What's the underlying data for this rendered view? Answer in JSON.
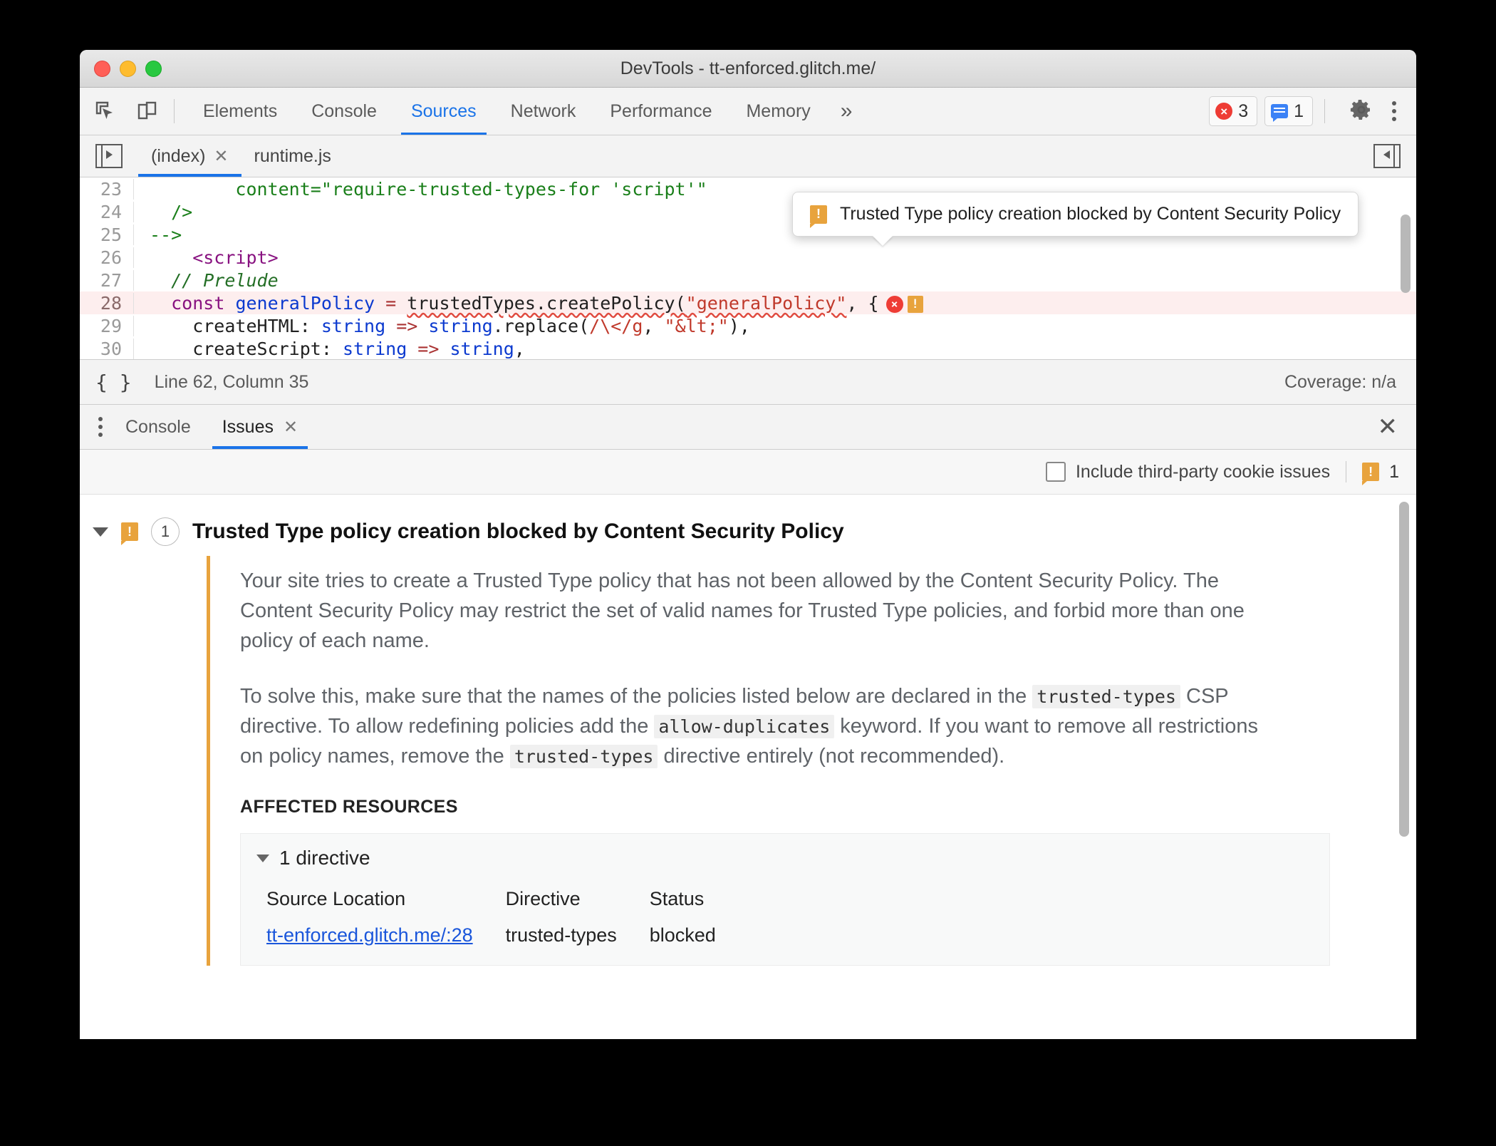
{
  "window": {
    "title": "DevTools - tt-enforced.glitch.me/"
  },
  "toolbar": {
    "inspect_icon": "inspect-cursor-icon",
    "device_icon": "device-toolbar-icon",
    "panels": [
      {
        "label": "Elements",
        "active": false
      },
      {
        "label": "Console",
        "active": false
      },
      {
        "label": "Sources",
        "active": true
      },
      {
        "label": "Network",
        "active": false
      },
      {
        "label": "Performance",
        "active": false
      },
      {
        "label": "Memory",
        "active": false
      }
    ],
    "more_panels_label": "»",
    "error_badge": {
      "icon": "error-circle-icon",
      "glyph": "×",
      "count": "3"
    },
    "message_badge": {
      "icon": "message-icon",
      "count": "1"
    },
    "settings_icon": "gear-icon",
    "menu_icon": "kebab-menu-icon",
    "accent_blue": "#1a73e8",
    "error_red": "#ee3c35",
    "warning_orange": "#e8a33d"
  },
  "file_tabs": {
    "navigator_icon": "show-navigator-icon",
    "collapse_icon": "collapse-sidebar-icon",
    "items": [
      {
        "label": "(index)",
        "active": true,
        "closable": true,
        "close_glyph": "✕"
      },
      {
        "label": "runtime.js",
        "active": false,
        "closable": false
      }
    ]
  },
  "editor": {
    "lines": [
      {
        "number": "23",
        "text": "    content=\"require-trusted-types-for 'script'\"",
        "highlight": false
      },
      {
        "number": "24",
        "text": "  />",
        "highlight": false
      },
      {
        "number": "25",
        "text": "-->",
        "highlight": false
      },
      {
        "number": "26",
        "text": "    <script>",
        "highlight": false
      },
      {
        "number": "27",
        "text": "  // Prelude",
        "highlight": false
      },
      {
        "number": "28",
        "text": "  const generalPolicy = trustedTypes.createPolicy(\"generalPolicy\", {",
        "highlight": true
      },
      {
        "number": "29",
        "text": "    createHTML: string => string.replace(/\\</g, \"&lt;\"),",
        "highlight": false
      },
      {
        "number": "30",
        "text": "    createScript: string => string,",
        "highlight": false
      }
    ],
    "line28_parts": {
      "kw_const": "const",
      "var_name": "generalPolicy",
      "eq": "=",
      "call": "trustedTypes.createPolicy(",
      "arg": "\"generalPolicy\"",
      "tail": ", {"
    },
    "line29_parts": {
      "prop": "    createHTML: ",
      "type1": "string",
      "arrow": " => ",
      "type2": "string",
      "dot": ".replace(",
      "regex": "/\\</g",
      "comma": ", ",
      "str": "\"&lt;\"",
      "end": "),"
    },
    "line30_parts": {
      "prop": "    createScript: ",
      "type1": "string",
      "arrow": " => ",
      "type2": "string",
      "end": ","
    },
    "inline_error_glyph": "×",
    "inline_warning_glyph": "!",
    "tooltip": {
      "icon": "warning-icon",
      "glyph": "!",
      "text": "Trusted Type policy creation blocked by Content Security Policy"
    }
  },
  "status_bar": {
    "pretty_print_icon": "pretty-print-braces-icon",
    "pretty_print_glyph": "{ }",
    "position": "Line 62, Column 35",
    "coverage": "Coverage: n/a"
  },
  "drawer": {
    "menu_icon": "kebab-menu-icon",
    "tabs": [
      {
        "label": "Console",
        "active": false,
        "closable": false
      },
      {
        "label": "Issues",
        "active": true,
        "closable": true,
        "close_glyph": "✕"
      }
    ],
    "close_glyph": "✕",
    "filter": {
      "checkbox_label": "Include third-party cookie issues",
      "checked": false,
      "warning_icon": "warning-icon",
      "warning_glyph": "!",
      "warning_count": "1"
    }
  },
  "issue": {
    "expanded": true,
    "icon": "warning-icon",
    "icon_glyph": "!",
    "count": "1",
    "title": "Trusted Type policy creation blocked by Content Security Policy",
    "paragraph1": "Your site tries to create a Trusted Type policy that has not been allowed by the Content Security Policy. The Content Security Policy may restrict the set of valid names for Trusted Type policies, and forbid more than one policy of each name.",
    "paragraph2": {
      "part1": "To solve this, make sure that the names of the policies listed below are declared in the ",
      "code1": "trusted-types",
      "part2": " CSP directive. To allow redefining policies add the ",
      "code2": "allow-duplicates",
      "part3": " keyword. If you want to remove all restrictions on policy names, remove the ",
      "code3": "trusted-types",
      "part4": " directive entirely (not recommended)."
    },
    "affected_resources_label": "AFFECTED RESOURCES",
    "resource_group": {
      "expanded": true,
      "summary": "1 directive",
      "columns": [
        "Source Location",
        "Directive",
        "Status"
      ],
      "rows": [
        {
          "source_location": "tt-enforced.glitch.me/:28",
          "directive": "trusted-types",
          "status": "blocked"
        }
      ]
    },
    "accent_orange": "#e8a33d",
    "status_red": "#e02b1d",
    "link_blue": "#1a56db"
  }
}
